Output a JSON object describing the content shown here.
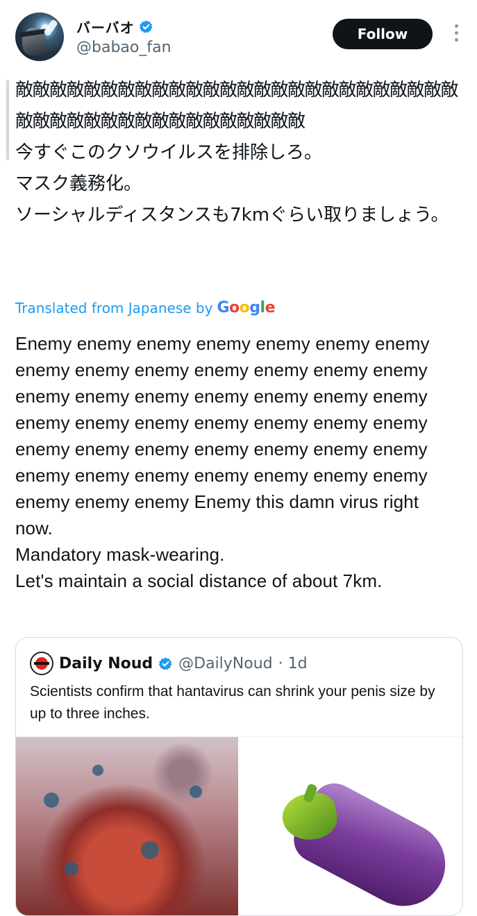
{
  "header": {
    "display_name": "バーバオ",
    "handle": "@babao_fan",
    "follow_label": "Follow",
    "verified_color": "#1d9bf0"
  },
  "post": {
    "original_text_enemies": "敵敵敵敵敵敵敵敵敵敵敵敵敵敵敵敵敵敵敵敵敵敵敵敵敵敵敵敵敵敵敵敵敵敵敵敵敵敵敵敵敵敵敵",
    "original_text_rest": "今すぐこのクソウイルスを排除しろ。\nマスク義務化。\nソーシャルディスタンスも7kmぐらい取りましょう。",
    "translated_label": "Translated from Japanese by",
    "translator": "Google",
    "translation": "Enemy enemy enemy enemy enemy enemy enemy enemy enemy enemy enemy enemy enemy enemy enemy enemy enemy enemy enemy enemy enemy enemy enemy enemy enemy enemy enemy enemy enemy enemy enemy enemy enemy enemy enemy enemy enemy enemy enemy enemy enemy enemy enemy enemy enemy Enemy this damn virus right now.\nMandatory mask-wearing.\nLet's maintain a social distance of about 7km."
  },
  "quote": {
    "name": "Daily Noud",
    "handle": "@DailyNoud",
    "time": "· 1d",
    "text": "Scientists confirm that hantavirus can shrink your penis size by up to three inches.",
    "media": [
      "virus-image",
      "eggplant-image"
    ]
  },
  "icons": [
    "verified-badge-icon",
    "more-options-icon",
    "google-logo-icon"
  ]
}
